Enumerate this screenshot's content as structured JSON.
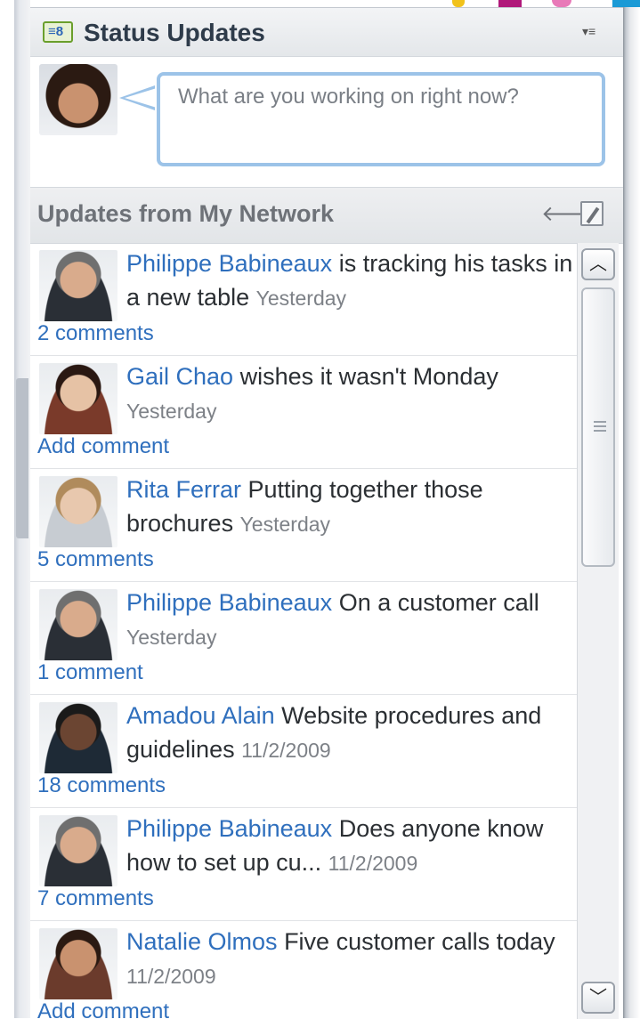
{
  "header": {
    "title": "Status Updates",
    "icon_text": "≡8",
    "menu_icon": "▾≡"
  },
  "composer": {
    "placeholder": "What are you working on right now?"
  },
  "network": {
    "title": "Updates from My Network",
    "back_icon": "🡐"
  },
  "feed": [
    {
      "author": "Philippe Babineaux",
      "text": " is tracking his tasks in a new table ",
      "time": "Yesterday",
      "comments": "2 comments"
    },
    {
      "author": "Gail Chao",
      "text": " wishes it wasn't Monday ",
      "time": "Yesterday",
      "comments": "Add comment"
    },
    {
      "author": "Rita Ferrar",
      "text": " Putting together those brochures ",
      "time": "Yesterday",
      "comments": "5 comments"
    },
    {
      "author": "Philippe Babineaux",
      "text": " On a customer call ",
      "time": "Yesterday",
      "comments": "1 comment"
    },
    {
      "author": "Amadou Alain",
      "text": " Website procedures and guidelines ",
      "time": "11/2/2009",
      "comments": "18 comments"
    },
    {
      "author": "Philippe Babineaux",
      "text": " Does anyone know how to set up cu... ",
      "time": "11/2/2009",
      "comments": "7 comments"
    },
    {
      "author": "Natalie Olmos",
      "text": " Five customer calls today ",
      "time": "11/2/2009",
      "comments": "Add comment"
    }
  ],
  "scrollbar": {
    "up_icon": "︿",
    "down_icon": "﹀"
  },
  "colors": {
    "link": "#2f6fbd",
    "header_text": "#2e3b4a",
    "input_border": "#9cc3e8"
  }
}
